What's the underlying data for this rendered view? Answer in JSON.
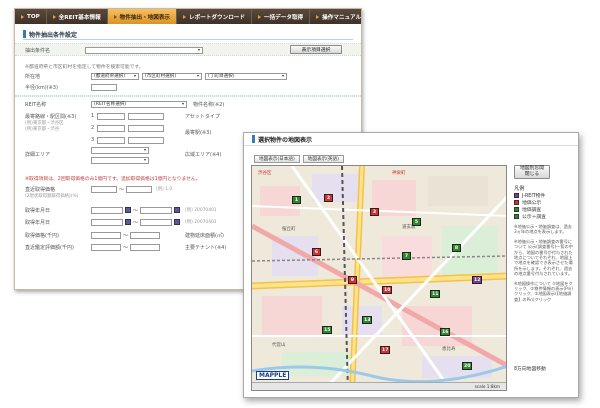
{
  "nav": {
    "items": [
      "TOP",
      "全REIT基本情報",
      "物件抽出・地図表示",
      "レポートダウンロード",
      "一括データ取得",
      "操作マニュアル"
    ],
    "active_index": 2
  },
  "search": {
    "title": "物件抽出条件設定",
    "saved_condition_label": "抽出条件名",
    "show_items_button": "表示項目選択",
    "note_address": "※都道府県と市区町村を指定して物件を検索可能です。",
    "address_label": "所在地",
    "pref_placeholder": "(都道府県選択)",
    "city_placeholder": "(市区町村選択)",
    "town_placeholder": "(丁町目選択)",
    "radius_label": "半径(km)(※3)",
    "reit_label": "REIT名称",
    "reit_placeholder": "(REIT名称選択)",
    "property_name_label": "物件名称(※2)",
    "station_label": "最寄路線・駅区間(※3)",
    "station_example": "(例)東京都・渋谷区",
    "station_example2": "(例)東京都・渋谷",
    "asset_type_label": "アセットタイプ",
    "station_label2": "最寄駅(※3)",
    "area_label": "詳細エリア",
    "area_label2": "広域エリア(※4)",
    "note_acq": "※取得項目は、2回取得価格のみ1億円です。追加取得価格は1億円となりません。",
    "price_label": "直近取得価格",
    "price_sub": "(2現状取得額取得価格)(%)",
    "price_hint": "(例) 1.0",
    "acq_date_label": "取得年月日",
    "date_hint": "(例) 20070401",
    "sale_date_label": "取得年月日",
    "sale_hint": "(例) 20070401",
    "rent_label": "取得価格(千円)",
    "rent_label2": "建物延床面積(㎡)",
    "area_m2_label": "直近鑑定評価額(千円)",
    "tenant_label": "主要テナント(※4)",
    "idx1": "1",
    "idx2": "2",
    "idx3": "3",
    "tilde": "～"
  },
  "map_window": {
    "title": "選択物件の地図表示",
    "tab1": "地図表示(日本語)",
    "tab2": "地図表示(英語)",
    "close_button_line1": "地図別窓開",
    "close_button_line2": "閉じる",
    "legend_title": "凡例",
    "legend": [
      {
        "label": "J-REIT物件",
        "color": "#7a3c9a"
      },
      {
        "label": "地価公示",
        "color": "#d83030"
      },
      {
        "label": "地価調査",
        "color": "#2a8a2a"
      },
      {
        "label": "公示＋調査",
        "color": "#2a8a2a"
      }
    ],
    "side_note": "※地価公示・地価調査は、過去3ヵ年の地点を表示します。",
    "side_note2": "※地価公示・地価調査の番号について 公示(調査番号)一覧の中から、地図の番号が付与された地点についてそれぞれ、地図上で地点を確認でき表示させた場所を示します。それぞれ、過去の地点番号付与されています。",
    "side_note3": "※地図操作について ①地図をクリック、②物件情報の表示(Pin)クリック、③地図表示(【地価調査】のPin)クリック",
    "footer": "8方向地図移動",
    "map_logo": "MAPPLE",
    "scale_text": "scale 1:8km",
    "map_labels": [
      "渋谷区",
      "神泉町",
      "桜丘町",
      "道玄坂",
      "代官山",
      "恵比寿"
    ],
    "pins": [
      {
        "n": "1",
        "c": "#2a8a2a"
      },
      {
        "n": "2",
        "c": "#d83030"
      },
      {
        "n": "3",
        "c": "#d83030"
      },
      {
        "n": "5",
        "c": "#2a8a2a"
      },
      {
        "n": "6",
        "c": "#d83030"
      },
      {
        "n": "7",
        "c": "#2a8a2a"
      },
      {
        "n": "8",
        "c": "#2a8a2a"
      },
      {
        "n": "9",
        "c": "#d83030"
      },
      {
        "n": "10",
        "c": "#d83030"
      },
      {
        "n": "11",
        "c": "#2a8a2a"
      },
      {
        "n": "12",
        "c": "#7a3c9a"
      },
      {
        "n": "13",
        "c": "#2a8a2a"
      },
      {
        "n": "15",
        "c": "#2a8a2a"
      },
      {
        "n": "16",
        "c": "#2a8a2a"
      },
      {
        "n": "17",
        "c": "#d83030"
      },
      {
        "n": "20",
        "c": "#2a8a2a"
      }
    ]
  }
}
